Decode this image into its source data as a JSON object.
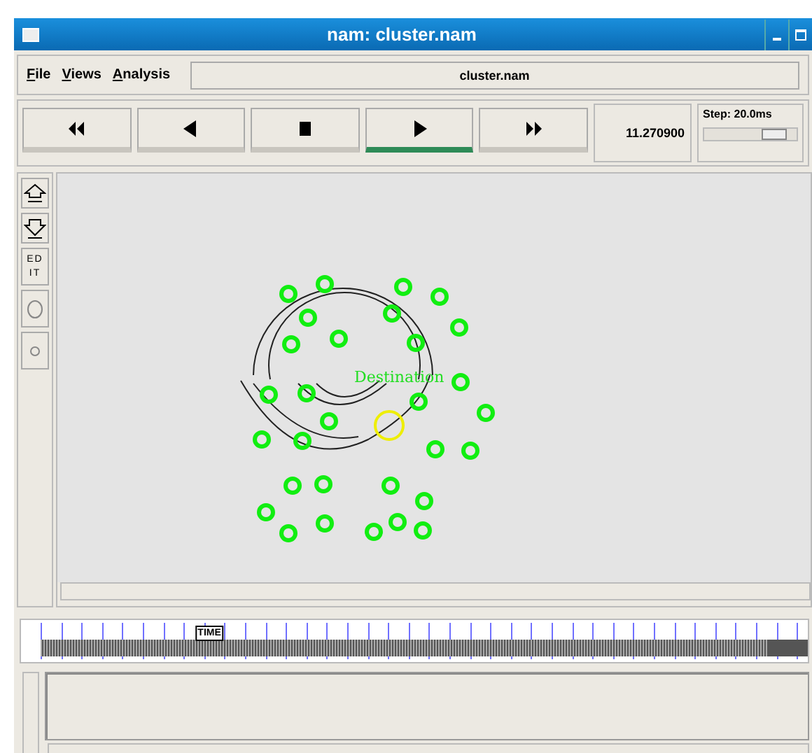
{
  "window": {
    "title": "nam: cluster.nam"
  },
  "menu": [
    {
      "label": "File"
    },
    {
      "label": "Views"
    },
    {
      "label": "Analysis"
    }
  ],
  "file_field": "cluster.nam",
  "controls": [
    {
      "kind": "rewind",
      "selected": false
    },
    {
      "kind": "back",
      "selected": false
    },
    {
      "kind": "stop",
      "selected": false
    },
    {
      "kind": "play",
      "selected": true
    },
    {
      "kind": "forward",
      "selected": false
    }
  ],
  "time": "11.270900",
  "step": {
    "label": "Step: 20.0ms",
    "level": 0.85
  },
  "tools": [
    {
      "kind": "zoom-in"
    },
    {
      "kind": "zoom-out"
    },
    {
      "kind": "edit",
      "label": "ED IT"
    },
    {
      "kind": "big-circle"
    },
    {
      "kind": "small-circle"
    }
  ],
  "canvas": {
    "destination_label": "Destination"
  },
  "timeline": {
    "marker": "TIME",
    "level": 0.22
  }
}
